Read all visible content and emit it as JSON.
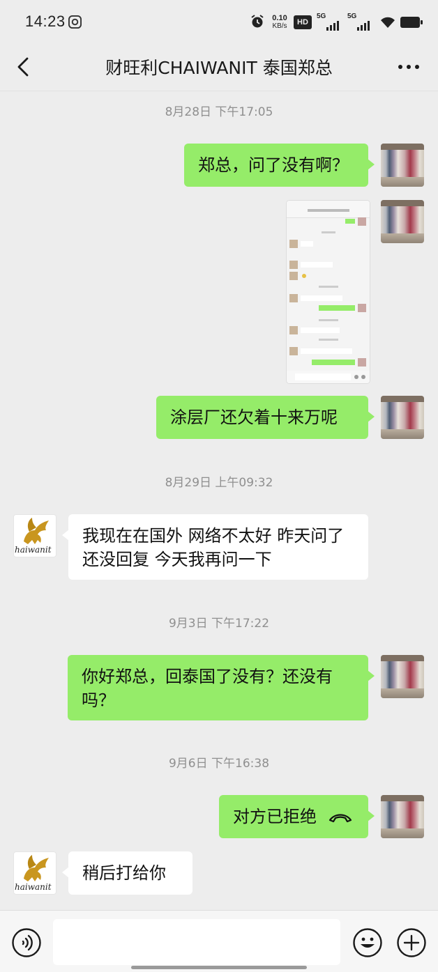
{
  "status_bar": {
    "time": "14:23",
    "net_speed_value": "0.10",
    "net_speed_unit": "KB/s",
    "hd_label": "HD",
    "sim1_label": "5G",
    "sim2_label": "5G"
  },
  "header": {
    "title": "财旺利CHAIWANIT 泰国郑总"
  },
  "messages": [
    {
      "timestamp": "8月28日 下午17:05"
    },
    {
      "text": "郑总，问了没有啊？"
    },
    {
      "text": "涂层厂还欠着十来万呢"
    },
    {
      "timestamp": "8月29日 上午09:32"
    },
    {
      "text": "我现在在国外 网络不太好 昨天问了 还没回复 今天我再问一下"
    },
    {
      "timestamp": "9月3日 下午17:22"
    },
    {
      "text": "你好郑总，回泰国了没有？还没有吗？"
    },
    {
      "timestamp": "9月6日 下午16:38"
    },
    {
      "text": "对方已拒绝"
    },
    {
      "text": "稍后打给你"
    }
  ],
  "avatar_text": "haiwanit",
  "colors": {
    "background": "#ededed",
    "my_bubble": "#95ec69",
    "their_bubble": "#ffffff",
    "timestamp_text": "#8f8f8f"
  },
  "icons": {
    "back": "chevron-left-icon",
    "more": "more-dots-icon",
    "voice": "voice-icon",
    "emoji": "emoji-icon",
    "plus": "plus-icon",
    "call_declined": "phone-hangup-icon"
  }
}
